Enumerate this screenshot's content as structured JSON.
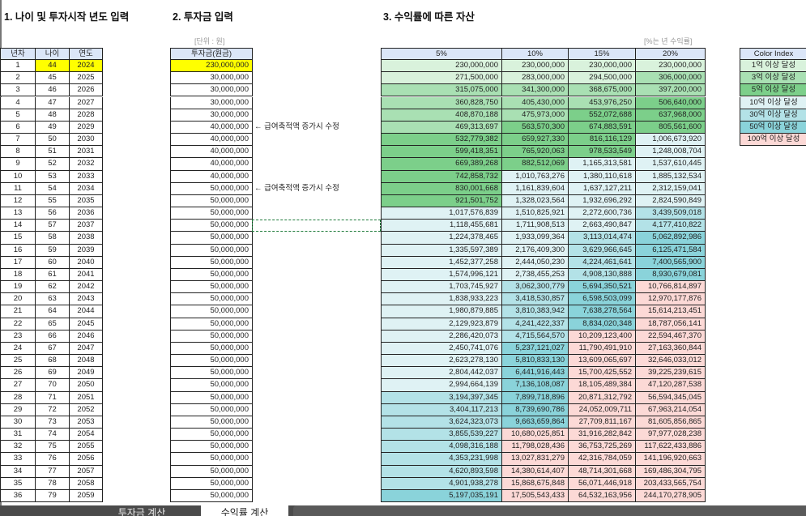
{
  "titles": {
    "section1": "1. 나이 및 투자시작 년도 입력",
    "section2": "2. 투자금 입력",
    "section3": "3. 수익률에 따른 자산"
  },
  "units": {
    "invest": "[단위 : 원]",
    "returns": "[%는 년 수익률]"
  },
  "age_table": {
    "headers": [
      "년차",
      "나이",
      "연도"
    ],
    "rows": [
      [
        "1",
        "44",
        "2024"
      ],
      [
        "2",
        "45",
        "2025"
      ],
      [
        "3",
        "46",
        "2026"
      ],
      [
        "4",
        "47",
        "2027"
      ],
      [
        "5",
        "48",
        "2028"
      ],
      [
        "6",
        "49",
        "2029"
      ],
      [
        "7",
        "50",
        "2030"
      ],
      [
        "8",
        "51",
        "2031"
      ],
      [
        "9",
        "52",
        "2032"
      ],
      [
        "10",
        "53",
        "2033"
      ],
      [
        "11",
        "54",
        "2034"
      ],
      [
        "12",
        "55",
        "2035"
      ],
      [
        "13",
        "56",
        "2036"
      ],
      [
        "14",
        "57",
        "2037"
      ],
      [
        "15",
        "58",
        "2038"
      ],
      [
        "16",
        "59",
        "2039"
      ],
      [
        "17",
        "60",
        "2040"
      ],
      [
        "18",
        "61",
        "2041"
      ],
      [
        "19",
        "62",
        "2042"
      ],
      [
        "20",
        "63",
        "2043"
      ],
      [
        "21",
        "64",
        "2044"
      ],
      [
        "22",
        "65",
        "2045"
      ],
      [
        "23",
        "66",
        "2046"
      ],
      [
        "24",
        "67",
        "2047"
      ],
      [
        "25",
        "68",
        "2048"
      ],
      [
        "26",
        "69",
        "2049"
      ],
      [
        "27",
        "70",
        "2050"
      ],
      [
        "28",
        "71",
        "2051"
      ],
      [
        "29",
        "72",
        "2052"
      ],
      [
        "30",
        "73",
        "2053"
      ],
      [
        "31",
        "74",
        "2054"
      ],
      [
        "32",
        "75",
        "2055"
      ],
      [
        "33",
        "76",
        "2056"
      ],
      [
        "34",
        "77",
        "2057"
      ],
      [
        "35",
        "78",
        "2058"
      ],
      [
        "36",
        "79",
        "2059"
      ]
    ]
  },
  "invest_table": {
    "header": "투자금(원금)",
    "rows": [
      "230,000,000",
      "30,000,000",
      "30,000,000",
      "30,000,000",
      "30,000,000",
      "40,000,000",
      "40,000,000",
      "40,000,000",
      "40,000,000",
      "40,000,000",
      "50,000,000",
      "50,000,000",
      "50,000,000",
      "50,000,000",
      "50,000,000",
      "50,000,000",
      "50,000,000",
      "50,000,000",
      "50,000,000",
      "50,000,000",
      "50,000,000",
      "50,000,000",
      "50,000,000",
      "50,000,000",
      "50,000,000",
      "50,000,000",
      "50,000,000",
      "50,000,000",
      "50,000,000",
      "50,000,000",
      "50,000,000",
      "50,000,000",
      "50,000,000",
      "50,000,000",
      "50,000,000",
      "50,000,000"
    ],
    "notes": [
      {
        "row": 6,
        "text": "← 급여축적액 증가시 수정"
      },
      {
        "row": 11,
        "text": "← 급여축적액 증가시 수정"
      }
    ]
  },
  "returns_table": {
    "headers": [
      "5%",
      "10%",
      "15%",
      "20%"
    ],
    "rows": [
      [
        "230,000,000",
        "230,000,000",
        "230,000,000",
        "230,000,000"
      ],
      [
        "271,500,000",
        "283,000,000",
        "294,500,000",
        "306,000,000"
      ],
      [
        "315,075,000",
        "341,300,000",
        "368,675,000",
        "397,200,000"
      ],
      [
        "360,828,750",
        "405,430,000",
        "453,976,250",
        "506,640,000"
      ],
      [
        "408,870,188",
        "475,973,000",
        "552,072,688",
        "637,968,000"
      ],
      [
        "469,313,697",
        "563,570,300",
        "674,883,591",
        "805,561,600"
      ],
      [
        "532,779,382",
        "659,927,330",
        "816,116,129",
        "1,006,673,920"
      ],
      [
        "599,418,351",
        "765,920,063",
        "978,533,549",
        "1,248,008,704"
      ],
      [
        "669,389,268",
        "882,512,069",
        "1,165,313,581",
        "1,537,610,445"
      ],
      [
        "742,858,732",
        "1,010,763,276",
        "1,380,110,618",
        "1,885,132,534"
      ],
      [
        "830,001,668",
        "1,161,839,604",
        "1,637,127,211",
        "2,312,159,041"
      ],
      [
        "921,501,752",
        "1,328,023,564",
        "1,932,696,292",
        "2,824,590,849"
      ],
      [
        "1,017,576,839",
        "1,510,825,921",
        "2,272,600,736",
        "3,439,509,018"
      ],
      [
        "1,118,455,681",
        "1,711,908,513",
        "2,663,490,847",
        "4,177,410,822"
      ],
      [
        "1,224,378,465",
        "1,933,099,364",
        "3,113,014,474",
        "5,062,892,986"
      ],
      [
        "1,335,597,389",
        "2,176,409,300",
        "3,629,966,645",
        "6,125,471,584"
      ],
      [
        "1,452,377,258",
        "2,444,050,230",
        "4,224,461,641",
        "7,400,565,900"
      ],
      [
        "1,574,996,121",
        "2,738,455,253",
        "4,908,130,888",
        "8,930,679,081"
      ],
      [
        "1,703,745,927",
        "3,062,300,779",
        "5,694,350,521",
        "10,766,814,897"
      ],
      [
        "1,838,933,223",
        "3,418,530,857",
        "6,598,503,099",
        "12,970,177,876"
      ],
      [
        "1,980,879,885",
        "3,810,383,942",
        "7,638,278,564",
        "15,614,213,451"
      ],
      [
        "2,129,923,879",
        "4,241,422,337",
        "8,834,020,348",
        "18,787,056,141"
      ],
      [
        "2,286,420,073",
        "4,715,564,570",
        "10,209,123,400",
        "22,594,467,370"
      ],
      [
        "2,450,741,076",
        "5,237,121,027",
        "11,790,491,910",
        "27,163,360,844"
      ],
      [
        "2,623,278,130",
        "5,810,833,130",
        "13,609,065,697",
        "32,646,033,012"
      ],
      [
        "2,804,442,037",
        "6,441,916,443",
        "15,700,425,552",
        "39,225,239,615"
      ],
      [
        "2,994,664,139",
        "7,136,108,087",
        "18,105,489,384",
        "47,120,287,538"
      ],
      [
        "3,194,397,345",
        "7,899,718,896",
        "20,871,312,792",
        "56,594,345,045"
      ],
      [
        "3,404,117,213",
        "8,739,690,786",
        "24,052,009,711",
        "67,963,214,054"
      ],
      [
        "3,624,323,073",
        "9,663,659,864",
        "27,709,811,167",
        "81,605,856,865"
      ],
      [
        "3,855,539,227",
        "10,680,025,851",
        "31,916,282,842",
        "97,977,028,238"
      ],
      [
        "4,098,316,188",
        "11,798,028,436",
        "36,753,725,269",
        "117,622,433,886"
      ],
      [
        "4,353,231,998",
        "13,027,831,279",
        "42,316,784,059",
        "141,196,920,663"
      ],
      [
        "4,620,893,598",
        "14,380,614,407",
        "48,714,301,668",
        "169,486,304,795"
      ],
      [
        "4,901,938,278",
        "15,868,675,848",
        "56,071,446,918",
        "203,433,565,754"
      ],
      [
        "5,197,035,191",
        "17,505,543,433",
        "64,532,163,956",
        "244,170,278,905"
      ]
    ]
  },
  "color_index": {
    "header": "Color Index",
    "items": [
      {
        "label": "1억 이상 달성",
        "threshold": 100000000,
        "color": "#d9f2dc"
      },
      {
        "label": "3억 이상 달성",
        "threshold": 300000000,
        "color": "#a9e0b3"
      },
      {
        "label": "5억 이상 달성",
        "threshold": 500000000,
        "color": "#7ccf8a"
      },
      {
        "label": "10억 이상 달성",
        "threshold": 1000000000,
        "color": "#dff2f4"
      },
      {
        "label": "30억 이상 달성",
        "threshold": 3000000000,
        "color": "#b3e2e7"
      },
      {
        "label": "50억 이상 달성",
        "threshold": 5000000000,
        "color": "#8ad3da"
      },
      {
        "label": "100억 이상 달성",
        "threshold": 10000000000,
        "color": "#fcd9d6"
      }
    ]
  },
  "colors": {
    "input_highlight": "#ffff00",
    "header_bg": "#dbe6f8"
  },
  "sheet_tabs": [
    {
      "label": "투자금 계산",
      "active": false
    },
    {
      "label": "수익률 계산",
      "active": true
    }
  ]
}
